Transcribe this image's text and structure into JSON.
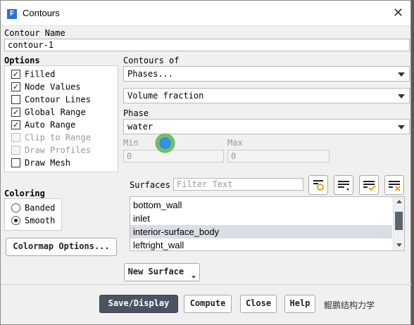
{
  "window": {
    "title": "Contours",
    "close_glyph": "✕"
  },
  "contour_name": {
    "label": "Contour Name",
    "value": "contour-1"
  },
  "options": {
    "label": "Options",
    "items": [
      {
        "label": "Filled",
        "checked": true,
        "enabled": true
      },
      {
        "label": "Node Values",
        "checked": true,
        "enabled": true
      },
      {
        "label": "Contour Lines",
        "checked": false,
        "enabled": true
      },
      {
        "label": "Global Range",
        "checked": true,
        "enabled": true
      },
      {
        "label": "Auto Range",
        "checked": true,
        "enabled": true
      },
      {
        "label": "Clip to Range",
        "checked": false,
        "enabled": false
      },
      {
        "label": "Draw Profiles",
        "checked": false,
        "enabled": false
      },
      {
        "label": "Draw Mesh",
        "checked": false,
        "enabled": true
      }
    ]
  },
  "contours_of": {
    "label": "Contours of",
    "category": "Phases...",
    "variable": "Volume fraction"
  },
  "phase": {
    "label": "Phase",
    "value": "water"
  },
  "range": {
    "min_label": "Min",
    "min_value": "0",
    "max_label": "Max",
    "max_value": "0"
  },
  "coloring": {
    "label": "Coloring",
    "options": [
      {
        "label": "Banded",
        "selected": false
      },
      {
        "label": "Smooth",
        "selected": true
      }
    ]
  },
  "colormap_button": "Colormap Options...",
  "surfaces": {
    "label": "Surfaces",
    "filter_placeholder": "Filter Text",
    "items": [
      "bottom_wall",
      "inlet",
      "interior-surface_body",
      "leftright_wall"
    ],
    "selected_index": 2
  },
  "new_surface_button": "New Surface",
  "footer": {
    "save_display": "Save/Display",
    "compute": "Compute",
    "close": "Close",
    "help": "Help"
  },
  "watermark": "鲲鹏结构力学"
}
